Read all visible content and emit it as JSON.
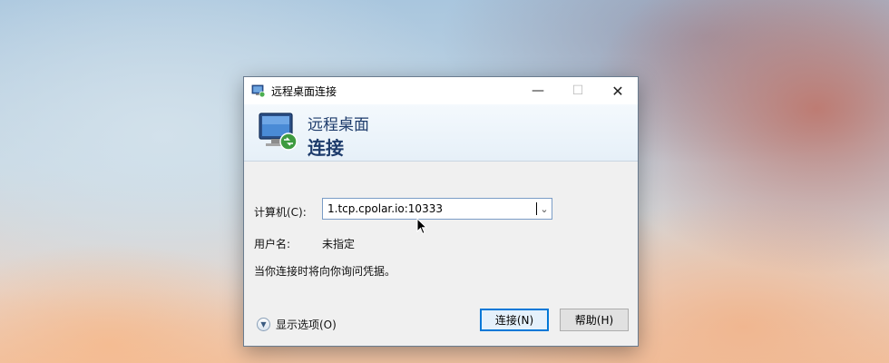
{
  "window": {
    "title": "远程桌面连接",
    "banner_line1": "远程桌面",
    "banner_line2": "连接"
  },
  "form": {
    "computer_label": "计算机(C):",
    "computer_value": "1.tcp.cpolar.io:10333",
    "username_label": "用户名:",
    "username_value": "未指定",
    "hint": "当你连接时将向你询问凭据。"
  },
  "footer": {
    "show_options": "显示选项(O)",
    "connect": "连接(N)",
    "help": "帮助(H)"
  },
  "icons": {
    "title": "remote-desktop-icon",
    "banner": "remote-desktop-icon",
    "options": "expand-options-icon"
  },
  "colors": {
    "accent": "#0078d7",
    "banner_text": "#1d3b6b"
  }
}
